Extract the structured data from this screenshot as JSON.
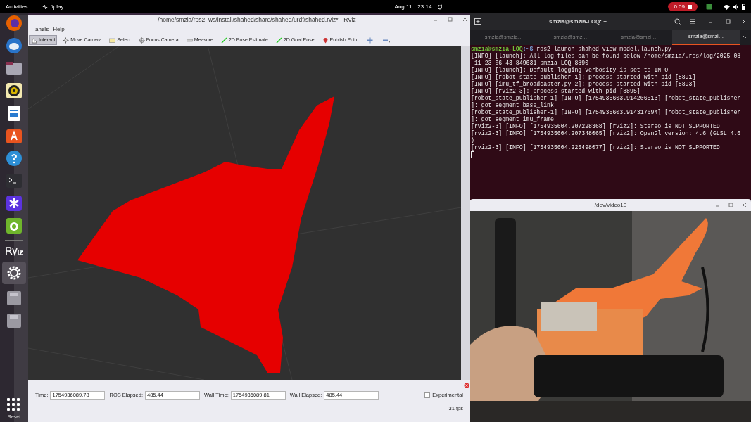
{
  "top_bar": {
    "activities": "Activities",
    "app": "ffplay",
    "date": "Aug 11",
    "time": "23:14",
    "recording": "0:09"
  },
  "rviz": {
    "title": "/home/smzia/ros2_ws/install/shahed/share/shahed/urdf/shahed.rviz* - RViz",
    "menu": [
      "anels",
      "Help"
    ],
    "tools": [
      {
        "label": "Interact",
        "kind": "interact",
        "selected": true
      },
      {
        "label": "Move Camera",
        "kind": "move",
        "selected": false
      },
      {
        "label": "Select",
        "kind": "select",
        "selected": false
      },
      {
        "label": "Focus Camera",
        "kind": "focus",
        "selected": false
      },
      {
        "label": "Measure",
        "kind": "measure",
        "selected": false
      },
      {
        "label": "2D Pose Estimate",
        "kind": "pose",
        "selected": false
      },
      {
        "label": "2D Goal Pose",
        "kind": "pose",
        "selected": false
      },
      {
        "label": "Publish Point",
        "kind": "point",
        "selected": false
      }
    ],
    "time_panel": {
      "fields": [
        {
          "label": "Time:",
          "value": "1754936089.78"
        },
        {
          "label": "ROS Elapsed:",
          "value": "485.44"
        },
        {
          "label": "Wall Time:",
          "value": "1754936089.81"
        },
        {
          "label": "Wall Elapsed:",
          "value": "485.44"
        }
      ],
      "experimental": {
        "label": "Experimental",
        "checked": false
      },
      "fps": "31 fps",
      "reset": "Reset"
    }
  },
  "terminal": {
    "title": "smzia@smzia-LOQ: ~",
    "tabs": [
      {
        "label": "smzia@smzia…",
        "selected": false
      },
      {
        "label": "smzia@smzi…",
        "selected": false
      },
      {
        "label": "smzia@smzi…",
        "selected": false
      },
      {
        "label": "smzia@smzi…",
        "selected": true
      }
    ],
    "prompt": "smzia@smzia-LOQ",
    "prompt_path": ":~$",
    "command": " ros2 launch shahed view_model.launch.py",
    "lines": [
      "[INFO] [launch]: All log files can be found below /home/smzia/.ros/log/2025-08",
      "-11-23-06-43-849631-smzia-LOQ-8890",
      "[INFO] [launch]: Default logging verbosity is set to INFO",
      "[INFO] [robot_state_publisher-1]: process started with pid [8891]",
      "[INFO] [imu_tf_broadcaster.py-2]: process started with pid [8893]",
      "[INFO] [rviz2-3]: process started with pid [8895]",
      "[robot_state_publisher-1] [INFO] [1754935603.914206513] [robot_state_publisher",
      "]: got segment base_link",
      "[robot_state_publisher-1] [INFO] [1754935603.914317694] [robot_state_publisher",
      "]: got segment imu_frame",
      "[rviz2-3] [INFO] [1754935604.207228368] [rviz2]: Stereo is NOT SUPPORTED",
      "[rviz2-3] [INFO] [1754935604.207348065] [rviz2]: OpenGl version: 4.6 (GLSL 4.6",
      ")",
      "[rviz2-3] [INFO] [1754935604.225498077] [rviz2]: Stereo is NOT SUPPORTED"
    ]
  },
  "video": {
    "title": "/dev/video10",
    "kind": "picture"
  }
}
